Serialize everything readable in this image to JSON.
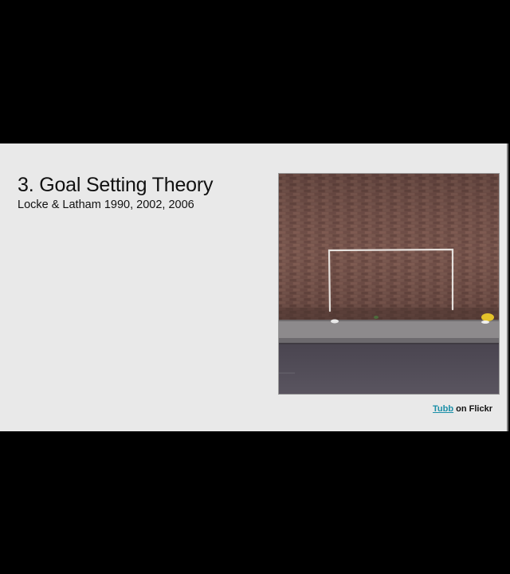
{
  "slide": {
    "title": "3. Goal Setting Theory",
    "subtitle": "Locke & Latham 1990, 2002, 2006",
    "image": {
      "description_icon": "photo-goalposts-on-brick-wall"
    },
    "credit": {
      "link_text": "Tubb",
      "suffix": " on Flickr"
    }
  },
  "colors": {
    "background": "#000000",
    "slide": "#e9e9e9",
    "link": "#1a8fa8"
  }
}
